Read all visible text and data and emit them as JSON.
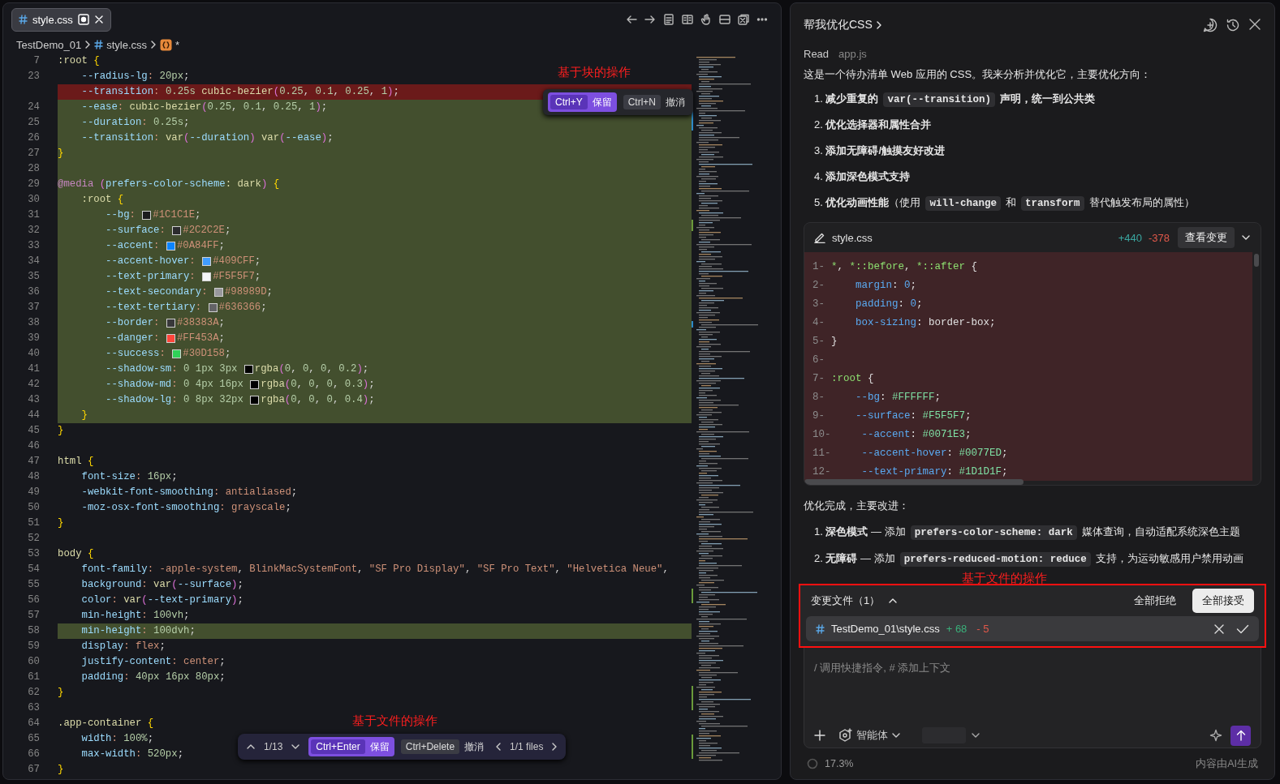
{
  "editor": {
    "tab": {
      "label": "style.css",
      "selected": true,
      "modified": true
    },
    "breadcrumbs": [
      {
        "kind": "folder",
        "label": "TestDemo_01"
      },
      {
        "kind": "css",
        "label": "style.css"
      },
      {
        "kind": "symbol",
        "label": "*"
      }
    ],
    "lines": [
      {
        "number": "7",
        "kind": "normal",
        "code": ":root {"
      },
      {
        "number": "23",
        "kind": "normal",
        "code": "    --radius-lg: 20px;"
      },
      {
        "kind": "removed",
        "code": "    --transition: 0.25s cubic-bezier(0.25, 0.1, 0.25, 1);"
      },
      {
        "number": "24",
        "kind": "added",
        "code": "    --ease: cubic-bezier(0.25, 0.1, 0.25, 1);"
      },
      {
        "number": "25",
        "kind": "added",
        "code": "    --duration: 0.25s;"
      },
      {
        "number": "26",
        "kind": "added",
        "code": "    --transition: var(--duration) var(--ease);"
      },
      {
        "number": "27",
        "kind": "added",
        "code": "}"
      },
      {
        "number": "28",
        "kind": "added"
      },
      {
        "number": "29",
        "kind": "added",
        "code": "@media (prefers-color-scheme: dark) {"
      },
      {
        "number": "30",
        "kind": "added",
        "code": "    :root {"
      },
      {
        "number": "31",
        "kind": "added",
        "code": "        --bg: ",
        "color": "#1c1c1e",
        "value": "#1C1C1E;"
      },
      {
        "number": "32",
        "kind": "added",
        "code": "        --surface: ",
        "color": "#2c2c2e",
        "value": "#2C2C2E;"
      },
      {
        "number": "33",
        "kind": "added",
        "code": "        --accent: ",
        "color": "#0a84ff",
        "value": "#0A84FF;"
      },
      {
        "number": "34",
        "kind": "added",
        "code": "        --accent-hover: ",
        "color": "#409cff",
        "value": "#409CFF;"
      },
      {
        "number": "35",
        "kind": "added",
        "code": "        --text-primary: ",
        "color": "#f5f5f7",
        "value": "#F5F5F7;"
      },
      {
        "number": "36",
        "kind": "added",
        "code": "        --text-secondary: ",
        "color": "#98989d",
        "value": "#98989D;"
      },
      {
        "number": "37",
        "kind": "added",
        "code": "        --text-tertiary: ",
        "color": "#636366",
        "value": "#636366;"
      },
      {
        "number": "38",
        "kind": "added",
        "code": "        --border: ",
        "color": "#38383a",
        "value": "#38383A;"
      },
      {
        "number": "39",
        "kind": "added",
        "code": "        --danger: ",
        "color": "#ff453a",
        "value": "#FF453A;"
      },
      {
        "number": "40",
        "kind": "added",
        "code": "        --success: ",
        "color": "#30d158",
        "value": "#30D158;"
      },
      {
        "number": "41",
        "kind": "added",
        "code": "        --shadow-sm: 0 1px 3px ",
        "color": "#000000",
        "value": "rgba(0, 0, 0, 0.2);"
      },
      {
        "number": "42",
        "kind": "added",
        "code": "        --shadow-md: 0 4px 16px ",
        "color": "#000000",
        "value": "rgba(0, 0, 0, 0.3);"
      },
      {
        "number": "43",
        "kind": "added",
        "code": "        --shadow-lg: 0 8px 32px ",
        "color": "#000000",
        "value": "rgba(0, 0, 0, 0.4);"
      },
      {
        "number": "44",
        "kind": "added",
        "code": "    }"
      },
      {
        "number": "45",
        "kind": "normal",
        "code": "}"
      },
      {
        "number": "46",
        "kind": "normal"
      },
      {
        "number": "47",
        "kind": "normal",
        "code": "html {"
      },
      {
        "number": "48",
        "kind": "normal",
        "code": "    font-size: 16px;"
      },
      {
        "number": "49",
        "kind": "normal",
        "code": "    -webkit-font-smoothing: antialiased;"
      },
      {
        "number": "50",
        "kind": "normal",
        "code": "    -moz-osx-font-smoothing: grayscale;"
      },
      {
        "number": "51",
        "kind": "normal",
        "code": "}"
      },
      {
        "number": "52",
        "kind": "normal"
      },
      {
        "number": "53",
        "kind": "normal",
        "code": "body {"
      },
      {
        "number": "54",
        "kind": "normal",
        "code": "    font-family: -apple-system, BlinkMacSystemFont, \"SF Pro Display\", \"SF Pro Text\", \"Helvetica Neue\","
      },
      {
        "number": "55",
        "kind": "normal",
        "code": "    background: var(--surface);"
      },
      {
        "number": "56",
        "kind": "normal",
        "code": "    color: var(--text-primary);"
      },
      {
        "number": "57",
        "kind": "normal",
        "code": "    min-height: 100vh;"
      },
      {
        "number": "58",
        "kind": "added",
        "code": "    min-height: 100dvh;"
      },
      {
        "number": "59",
        "kind": "normal",
        "code": "    display: flex;"
      },
      {
        "number": "60",
        "kind": "normal",
        "code": "    justify-content: center;"
      },
      {
        "number": "61",
        "kind": "normal",
        "code": "    padding: 40px 16px 80px;"
      },
      {
        "number": "62",
        "kind": "normal",
        "code": "}"
      },
      {
        "number": "63",
        "kind": "normal"
      },
      {
        "number": "64",
        "kind": "normal",
        "code": ".app-container {"
      },
      {
        "number": "65",
        "kind": "normal",
        "code": "    width: 100%;"
      },
      {
        "number": "66",
        "kind": "normal",
        "code": "    max-width: 520px;"
      },
      {
        "number": "67",
        "kind": "normal",
        "code": "}"
      }
    ],
    "block_actions": {
      "annotation": "基于块的操作",
      "keep": {
        "shortcut": "Ctrl+Y",
        "label": "保留"
      },
      "discard": {
        "shortcut": "Ctrl+N",
        "label": "撤消"
      }
    },
    "file_actions": {
      "annotation": "基于文件的操作",
      "position": "1/13",
      "keep": {
        "shortcut": "Ctrl+Enter",
        "label": "保留"
      },
      "discard": {
        "shortcut": "Ctrl+Delete",
        "label": "撤消"
      },
      "files": "1/1 files"
    }
  },
  "chat": {
    "title": "帮我优化CSS",
    "read": {
      "label": "Read",
      "file": "app.js"
    },
    "intro": "这是一个待办清单 Web 应用的 CSS。我来分析并优化它，主要优化方向：",
    "plan": [
      {
        "parts": [
          {
            "kind": "text",
            "text": "1. **减少重复的**"
          },
          {
            "kind": "code",
            "text": "var(--transition)"
          },
          {
            "kind": "text",
            "text": "**声明，统一到公共类**"
          }
        ]
      },
      {
        "parts": [
          {
            "kind": "text",
            "text": "2. **优化选择器和属性合并**"
          }
        ]
      },
      {
        "parts": [
          {
            "kind": "text",
            "text": "3. **添加无障碍/触摸友好改进**"
          }
        ]
      },
      {
        "parts": [
          {
            "kind": "text",
            "text": "4. **添加深色模式支持**"
          }
        ]
      },
      {
        "parts": [
          {
            "kind": "text",
            "text": "5. **优化动画性能**（使用"
          },
          {
            "kind": "code",
            "text": "will-change"
          },
          {
            "kind": "text",
            "text": "和"
          },
          {
            "kind": "code",
            "text": "transform"
          },
          {
            "kind": "text",
            "text": "替代触发布局的属性）"
          }
        ]
      }
    ],
    "diff_card": {
      "file": "style.css",
      "added": "+440",
      "removed": "-378",
      "button": "查看变更",
      "lines": [
        {
          "number": "1-",
          "code": "*, *::before, *::after {"
        },
        {
          "number": "2-",
          "code": "    margin: 0;"
        },
        {
          "number": "3-",
          "code": "    padding: 0;"
        },
        {
          "number": "4-",
          "code": "    box-sizing: border-box;"
        },
        {
          "number": "5-",
          "code": "}"
        },
        {
          "number": "6-"
        },
        {
          "number": "7-",
          "code": ":root {"
        },
        {
          "number": "8-",
          "code": "    --bg: #FFFFFF;"
        },
        {
          "number": "9-",
          "code": "    --surface: #F5F5F7;"
        },
        {
          "number": "10-",
          "code": "    --accent: #0071E3;"
        },
        {
          "number": "11-",
          "code": "    --accent-hover: #0077ED;"
        },
        {
          "number": "12-",
          "code": "    --text-primary: #1D1D1F;"
        }
      ]
    },
    "summary": "优化完成，主要改进：",
    "improvements": [
      {
        "parts": [
          {
            "kind": "text",
            "text": "1. **深色模式** — 添加"
          },
          {
            "kind": "code",
            "text": "prefers-color-scheme: dark"
          },
          {
            "kind": "text",
            "text": "媒体查询，自动适配系统深色主题"
          }
        ]
      },
      {
        "parts": [
          {
            "kind": "text",
            "text": "2. **无障碍** — 添加"
          },
          {
            "kind": "code",
            "text": "prefers-reduced-motion: reduce"
          },
          {
            "kind": "text",
            "text": "支持，为运动敏感用户禁用动画"
          }
        ]
      }
    ],
    "changes": {
      "annotation": "基于文件的操作",
      "title": "变更文件（1）",
      "expanded": true,
      "reject_all": "全部拒绝",
      "accept_all": "全部接受",
      "files": [
        {
          "path": "TestDemo_01\\style.css",
          "added": "+ 68",
          "removed": "- 5"
        }
      ]
    },
    "input": {
      "placeholder": "/ 调用快捷指令, # 添加上下文",
      "mode": "智能体"
    },
    "footer": {
      "progress": "17.3%",
      "note": "内容由AI生成"
    }
  }
}
